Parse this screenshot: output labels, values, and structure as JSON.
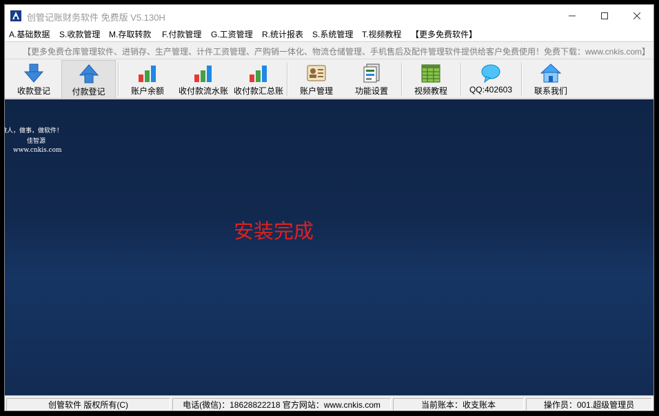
{
  "window": {
    "title": "创管记账财务软件 免费版  V5.130H"
  },
  "menu": [
    "A.基础数据",
    "S.收款管理",
    "M.存取转款",
    "F.付款管理",
    "G.工资管理",
    "R.统计报表",
    "S.系统管理",
    "T.视频教程",
    "【更多免费软件】"
  ],
  "marquee": "【更多免费仓库管理软件、进销存、生产管理、计件工资管理、产购销一体化、物流仓储管理、手机售后及配件管理软件提供给客户免费使用！免费下载：www.cnkis.com】",
  "toolbar": [
    {
      "label": "收款登记",
      "icon": "arrow-down-icon"
    },
    {
      "label": "付款登记",
      "icon": "arrow-up-icon"
    },
    {
      "label": "账户余额",
      "icon": "bar-chart-icon"
    },
    {
      "label": "收付款流水账",
      "icon": "bar-chart-icon"
    },
    {
      "label": "收付款汇总账",
      "icon": "bar-chart-icon"
    },
    {
      "label": "账户管理",
      "icon": "contact-card-icon"
    },
    {
      "label": "功能设置",
      "icon": "settings-doc-icon"
    },
    {
      "label": "视频教程",
      "icon": "spreadsheet-icon"
    },
    {
      "label": "QQ:402603",
      "icon": "chat-bubble-icon"
    },
    {
      "label": "联系我们",
      "icon": "home-icon"
    }
  ],
  "main": {
    "motto_line1": "做人，做事，做软件！",
    "motto_line2": "佳智源",
    "motto_line3": "www.cnkis.com",
    "install_message": "安装完成"
  },
  "status": {
    "copyright": "创管软件 版权所有(C)",
    "contact": "电话(微信)：18628822218 官方网站：www.cnkis.com",
    "account": "当前账本：收支账本",
    "operator": "操作员：001.超级管理员"
  },
  "colors": {
    "main_bg": "#12294f",
    "install_text": "#e02020"
  }
}
